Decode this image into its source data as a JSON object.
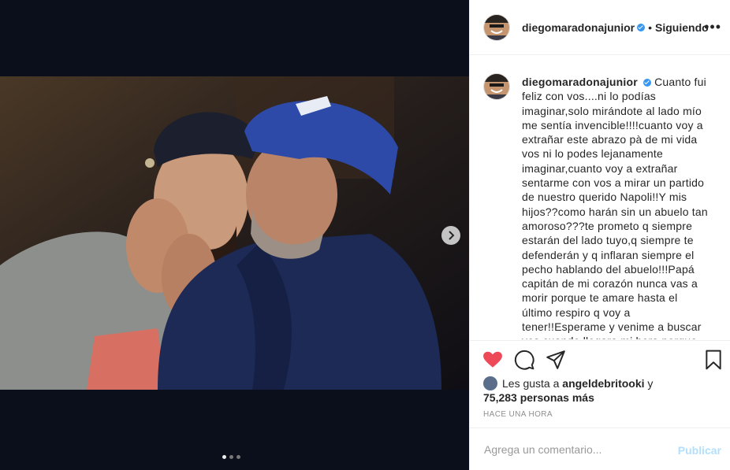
{
  "post": {
    "username": "diegomaradonajunior",
    "follow_separator": "•",
    "follow_label": "Siguiendo",
    "more_label": "•••"
  },
  "caption": {
    "username": "diegomaradonajunior",
    "text": "Cuanto fui feliz con vos....ni lo podías imaginar,solo mirándote al lado mío me sentía invencible!!!!cuanto voy a extrañar este abrazo pà de mi vida vos ni lo podes lejanamente imaginar,cuanto voy a extrañar sentarme con vos a mirar un partido de nuestro querido Napoli!!Y mis hijos??como harán sin un abuelo tan amoroso???te prometo q siempre estarán del lado tuyo,q siempre te defenderán y q inflaran siempre el pecho hablando del abuelo!!!Papá capitán de mi corazón nunca vas a morir porque te amare hasta el último respiro q voy a tener!!Esperame y venime a buscar vos cuando llegara mi hora porque siempre te quise al lado"
  },
  "likes": {
    "prefix": "Les gusta a ",
    "user": "angeldebritooki",
    "connector": " y",
    "count": "75,283 personas más"
  },
  "timestamp": "HACE UNA HORA",
  "comment": {
    "placeholder": "Agrega un comentario...",
    "post_label": "Publicar"
  },
  "carousel": {
    "total": 3,
    "current": 1
  },
  "colors": {
    "heart": "#ed4956",
    "verified": "#3897f0",
    "publish": "#b2dffc"
  },
  "icons": [
    "heart-icon",
    "comment-icon",
    "share-icon",
    "bookmark-icon",
    "chevron-right-icon",
    "verified-icon"
  ]
}
